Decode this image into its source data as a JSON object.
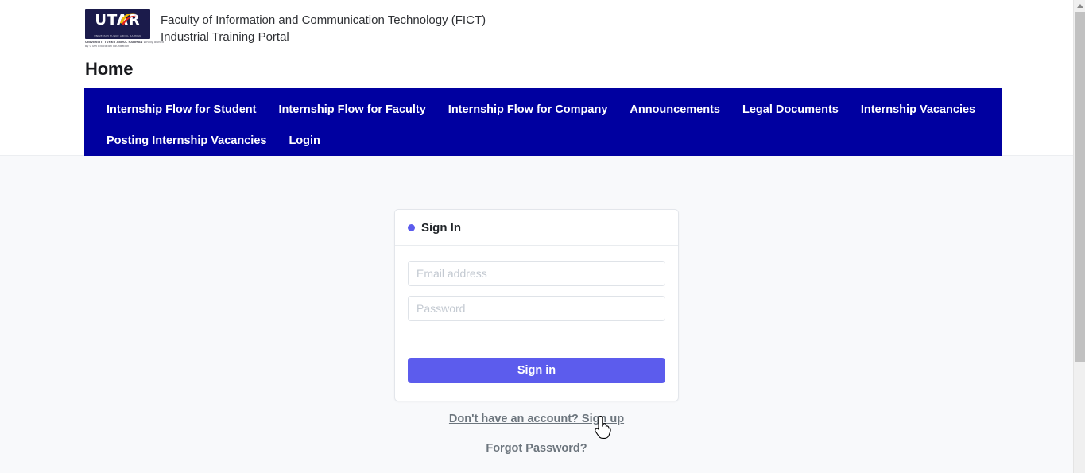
{
  "header": {
    "logo": {
      "name": "utar-logo",
      "wordmark": "UTAR",
      "box_subtext": "UNIVERSITI TUNKU ABDUL RAHMAN",
      "caption_bold": "UNIVERSITI TUNKU ABDUL RAHMAN",
      "caption_thin": "Wholly owned by UTAR Education Foundation"
    },
    "title_line1": "Faculty of Information and Communication Technology (FICT)",
    "title_line2": "Industrial Training Portal"
  },
  "page_title": "Home",
  "navbar": {
    "background": "#0000a0",
    "items": [
      {
        "label": "Internship Flow for Student"
      },
      {
        "label": "Internship Flow for Faculty"
      },
      {
        "label": "Internship Flow for Company"
      },
      {
        "label": "Announcements"
      },
      {
        "label": "Legal Documents"
      },
      {
        "label": "Internship Vacancies"
      },
      {
        "label": "Posting Internship Vacancies"
      },
      {
        "label": "Login"
      }
    ]
  },
  "signin_card": {
    "title": "Sign In",
    "dot_color": "#5c5ced",
    "email": {
      "value": "",
      "placeholder": "Email address"
    },
    "password": {
      "value": "",
      "placeholder": "Password"
    },
    "submit_label": "Sign in",
    "submit_color": "#5c5ced"
  },
  "links": {
    "signup": "Don't have an account? Sign up",
    "forgot": "Forgot Password?",
    "color": "#6c757d"
  },
  "colors": {
    "page_background": "#f8f9fb",
    "header_background": "#ffffff",
    "nav_blue": "#0000a0",
    "accent_indigo": "#5c5ced"
  }
}
